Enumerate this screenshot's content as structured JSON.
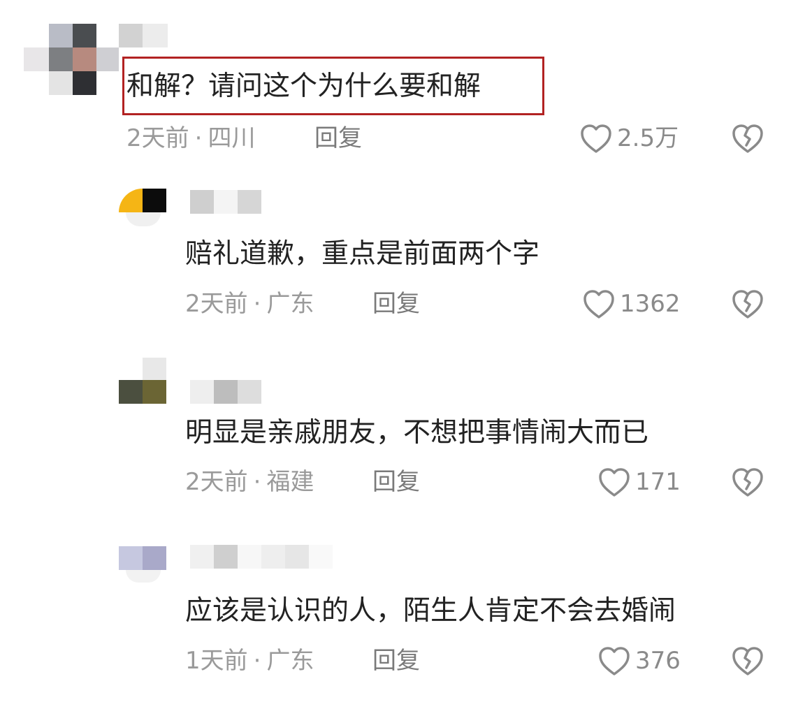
{
  "comments": [
    {
      "text": "和解？请问这个为什么要和解",
      "time": "2天前",
      "location": "四川",
      "reply_label": "回复",
      "likes": "2.5万"
    },
    {
      "text": "赔礼道歉，重点是前面两个字",
      "time": "2天前",
      "location": "广东",
      "reply_label": "回复",
      "likes": "1362"
    },
    {
      "text": "明显是亲戚朋友，不想把事情闹大而已",
      "time": "2天前",
      "location": "福建",
      "reply_label": "回复",
      "likes": "171"
    },
    {
      "text": "应该是认识的人，陌生人肯定不会去婚闹",
      "time": "1天前",
      "location": "广东",
      "reply_label": "回复",
      "likes": "376"
    }
  ],
  "separator": "·",
  "icons": {
    "like": "heart-outline-icon",
    "dislike": "broken-heart-icon"
  },
  "colors": {
    "highlight_border": "#b22222",
    "text": "#222222",
    "meta": "#9a9a9a"
  }
}
